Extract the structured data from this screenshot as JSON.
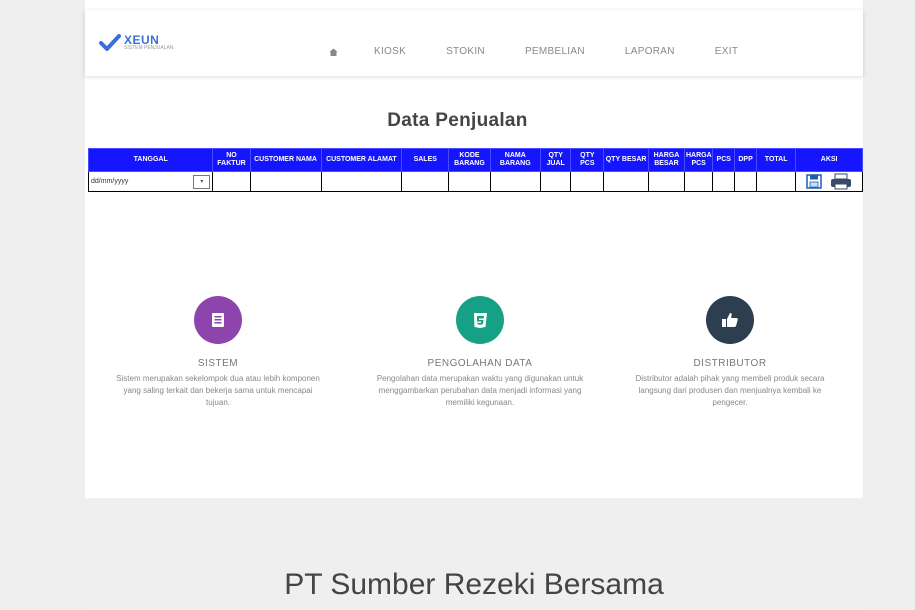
{
  "brand": {
    "name": "XEUN",
    "subtitle": "SISTEM PENJUALAN",
    "accent": "#3b6fd8"
  },
  "nav": {
    "items": [
      "KIOSK",
      "STOKIN",
      "PEMBELIAN",
      "LAPORAN",
      "EXIT"
    ]
  },
  "page_title": "Data Penjualan",
  "table": {
    "header_color": "#1515ff",
    "columns": [
      "TANGGAL",
      "NO FAKTUR",
      "CUSTOMER NAMA",
      "CUSTOMER ALAMAT",
      "SALES",
      "KODE BARANG",
      "NAMA BARANG",
      "QTY JUAL",
      "QTY PCS",
      "QTY BESAR",
      "HARGA BESAR",
      "HARGA PCS",
      "PCS",
      "DPP",
      "TOTAL",
      "AKSI"
    ],
    "row": {
      "date_value": "dd/mm/yyyy",
      "cal_label": "▾"
    }
  },
  "features": [
    {
      "title": "SISTEM",
      "color": "#8e44ad",
      "icon": "document-icon",
      "desc": "Sistem merupakan sekelompok dua atau lebih komponen yang saling terkait dan bekerja sama untuk mencapai tujuan."
    },
    {
      "title": "PENGOLAHAN DATA",
      "color": "#16a085",
      "icon": "css-icon",
      "desc": "Pengolahan data merupakan waktu yang digunakan untuk menggambarkan perubahan data menjadi informasi yang memiliki kegunaan."
    },
    {
      "title": "DISTRIBUTOR",
      "color": "#2c3e50",
      "icon": "thumbs-up-icon",
      "desc": "Distributor adalah pihak yang membeli produk secara langsung dari produsen dan menjualnya kembali ke pengecer."
    }
  ],
  "company": "PT Sumber Rezeki Bersama"
}
